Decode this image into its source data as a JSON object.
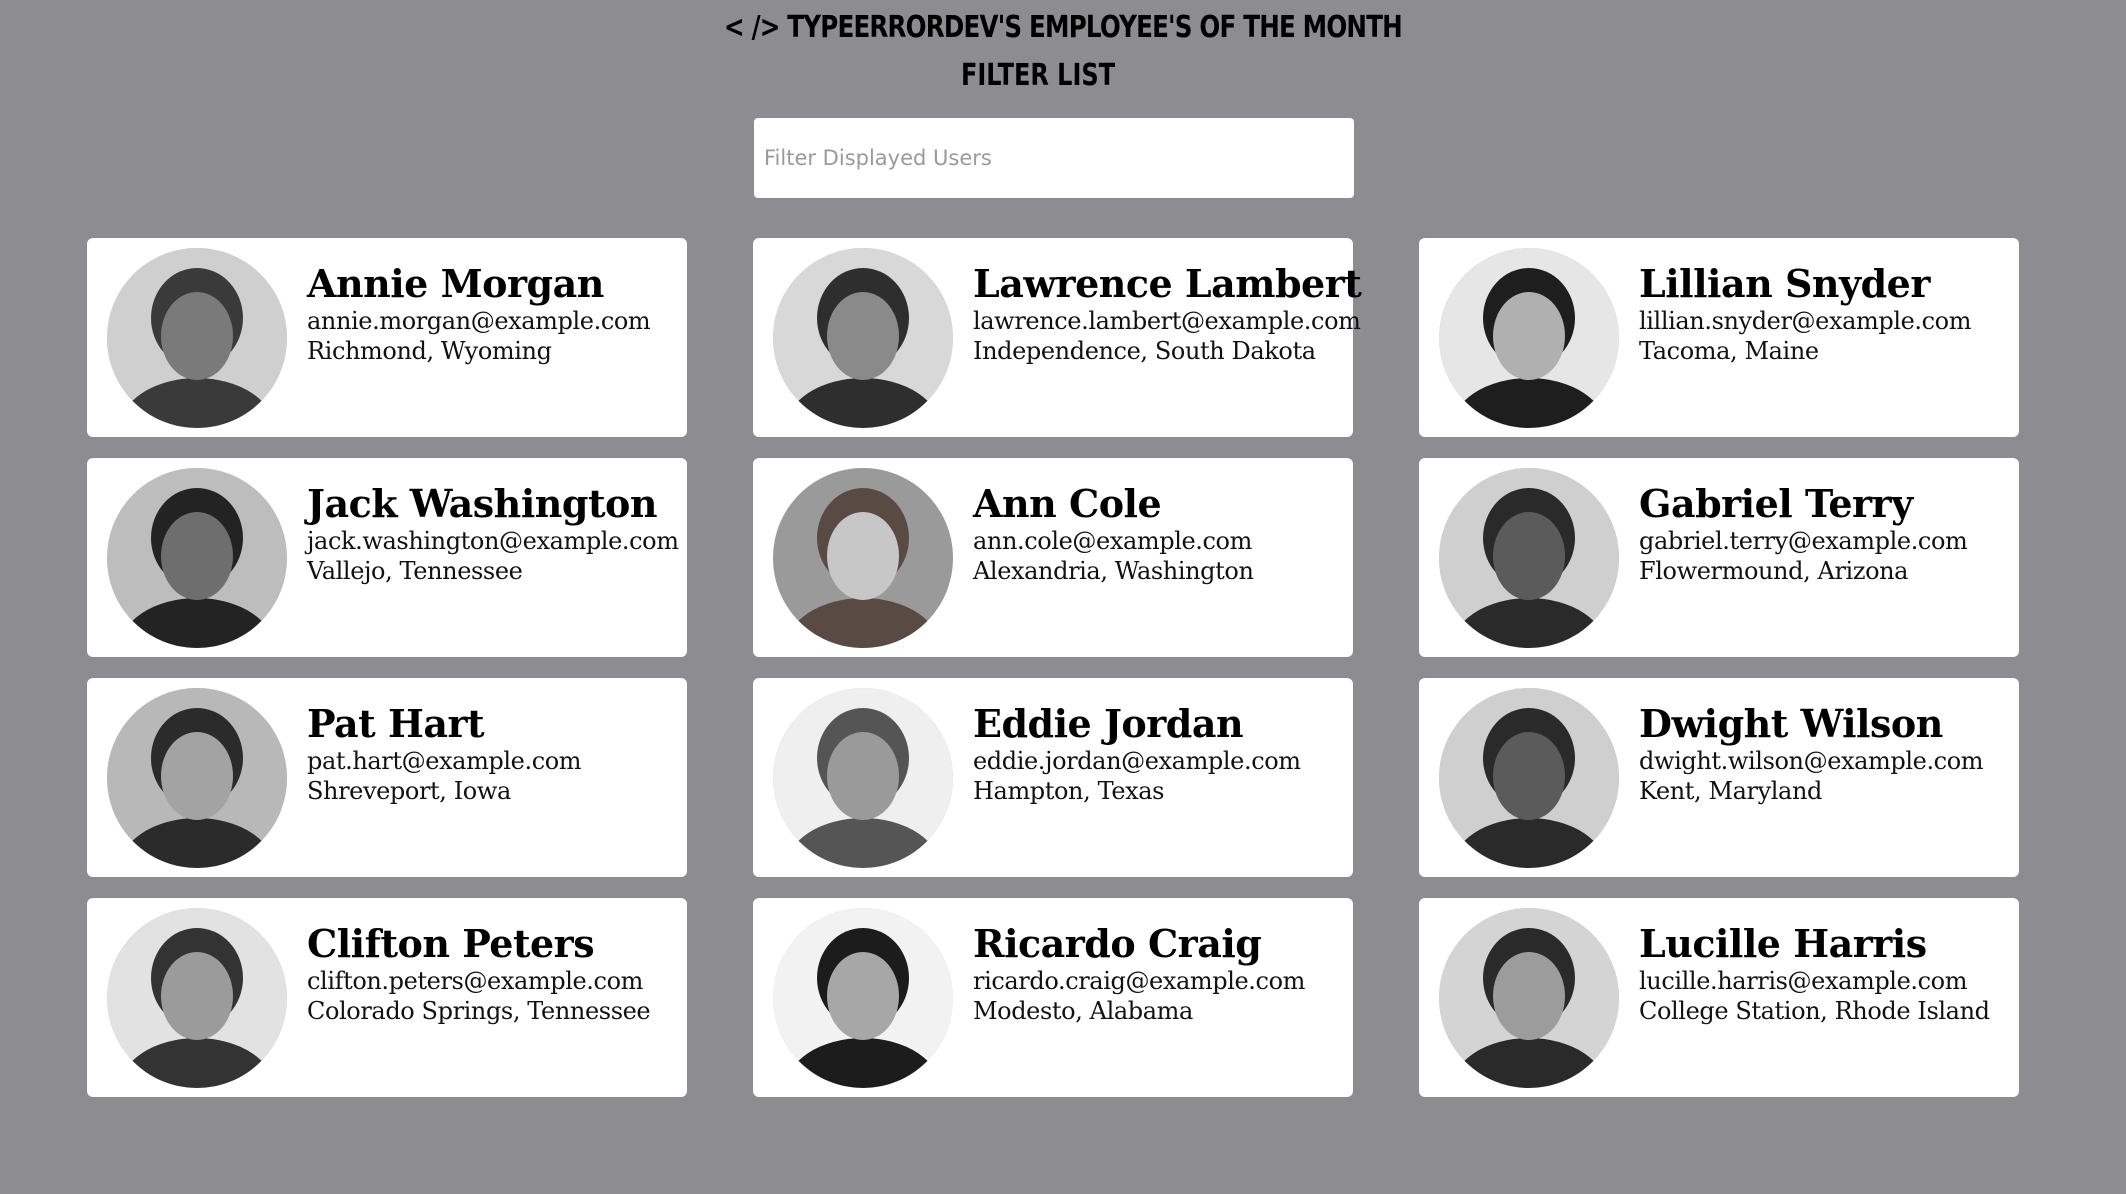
{
  "header": {
    "title": "< /> TypeErrorDev's Employee's of the Month",
    "filter_heading": "Filter List"
  },
  "search": {
    "placeholder": "Filter Displayed Users",
    "value": ""
  },
  "employees": [
    {
      "name": "Annie Morgan",
      "email": "annie.morgan@example.com",
      "location": "Richmond, Wyoming"
    },
    {
      "name": "Lawrence Lambert",
      "email": "lawrence.lambert@example.com",
      "location": "Independence, South Dakota"
    },
    {
      "name": "Lillian Snyder",
      "email": "lillian.snyder@example.com",
      "location": "Tacoma, Maine"
    },
    {
      "name": "Jack Washington",
      "email": "jack.washington@example.com",
      "location": "Vallejo, Tennessee"
    },
    {
      "name": "Ann Cole",
      "email": "ann.cole@example.com",
      "location": "Alexandria, Washington"
    },
    {
      "name": "Gabriel Terry",
      "email": "gabriel.terry@example.com",
      "location": "Flowermound, Arizona"
    },
    {
      "name": "Pat Hart",
      "email": "pat.hart@example.com",
      "location": "Shreveport, Iowa"
    },
    {
      "name": "Eddie Jordan",
      "email": "eddie.jordan@example.com",
      "location": "Hampton, Texas"
    },
    {
      "name": "Dwight Wilson",
      "email": "dwight.wilson@example.com",
      "location": "Kent, Maryland"
    },
    {
      "name": "Clifton Peters",
      "email": "clifton.peters@example.com",
      "location": "Colorado Springs, Tennessee"
    },
    {
      "name": "Ricardo Craig",
      "email": "ricardo.craig@example.com",
      "location": "Modesto, Alabama"
    },
    {
      "name": "Lucille Harris",
      "email": "lucille.harris@example.com",
      "location": "College Station, Rhode Island"
    }
  ],
  "colors": {
    "page_background": "#8c8c91",
    "card_background": "#ffffff",
    "text": "#000000"
  }
}
